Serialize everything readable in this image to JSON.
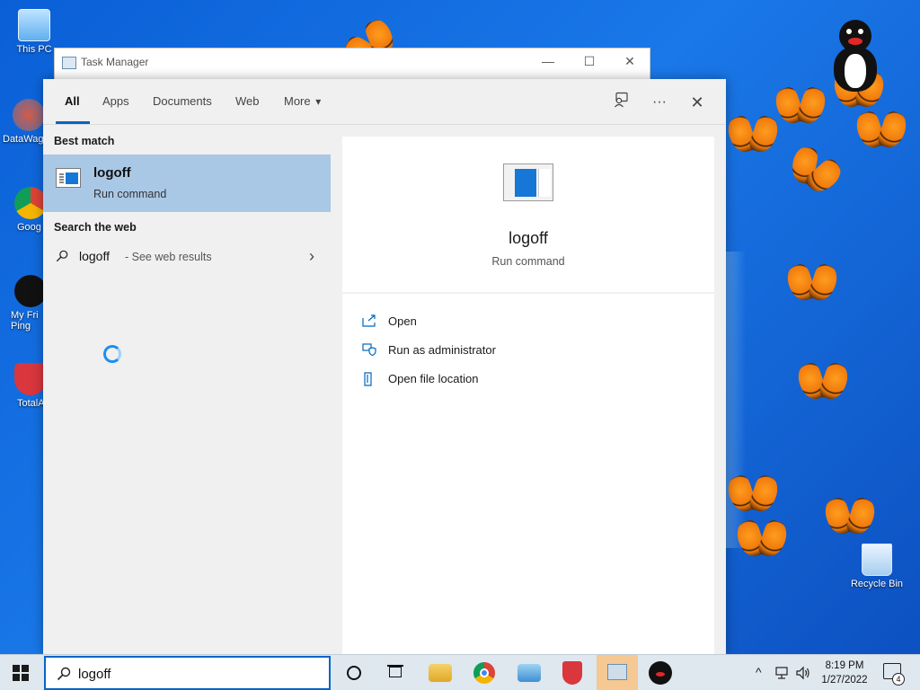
{
  "desktop": {
    "icons": [
      {
        "label": "This PC",
        "icon": "computer-icon"
      },
      {
        "label": "DataWag",
        "icon": "gear-sphere-icon"
      },
      {
        "label": "Goog",
        "icon": "chrome-icon"
      },
      {
        "label": "My Fri Ping",
        "icon": "penguin-icon"
      },
      {
        "label": "TotalA",
        "icon": "shield-icon"
      },
      {
        "label": "Recycle Bin",
        "icon": "recycle-bin-icon"
      }
    ]
  },
  "task_manager": {
    "title": "Task Manager",
    "controls": {
      "minimize": "—",
      "maximize": "☐",
      "close": "✕"
    }
  },
  "search_panel": {
    "tabs": [
      {
        "label": "All",
        "active": true
      },
      {
        "label": "Apps"
      },
      {
        "label": "Documents"
      },
      {
        "label": "Web"
      },
      {
        "label": "More"
      }
    ],
    "more_chevron": "▾",
    "header_icons": {
      "feedback": "feedback-icon",
      "options": "···",
      "close": "✕"
    },
    "best_match": {
      "section_title": "Best match",
      "name": "logoff",
      "type": "Run command"
    },
    "web": {
      "section_title": "Search the web",
      "query": "logoff",
      "suffix": "- See web results",
      "chevron": "›"
    },
    "preview": {
      "name": "logoff",
      "type": "Run command",
      "actions": [
        {
          "label": "Open",
          "icon": "open-icon"
        },
        {
          "label": "Run as administrator",
          "icon": "shield-admin-icon"
        },
        {
          "label": "Open file location",
          "icon": "file-location-icon"
        }
      ]
    }
  },
  "taskbar": {
    "search_value": "logoff",
    "apps": [
      "cortana-icon",
      "task-view-icon",
      "file-explorer-icon",
      "chrome-icon",
      "network-search-icon",
      "security-shield-icon",
      "task-manager-icon",
      "penguin-icon"
    ],
    "tray": {
      "chevron": "^"
    },
    "clock_time": "8:19 PM",
    "clock_date": "1/27/2022",
    "notification_count": "4"
  },
  "colors": {
    "accent": "#0067c0",
    "selection": "#a9c8e6",
    "panel_bg": "#f0f0f0",
    "desktop": "#0a5fd6"
  }
}
